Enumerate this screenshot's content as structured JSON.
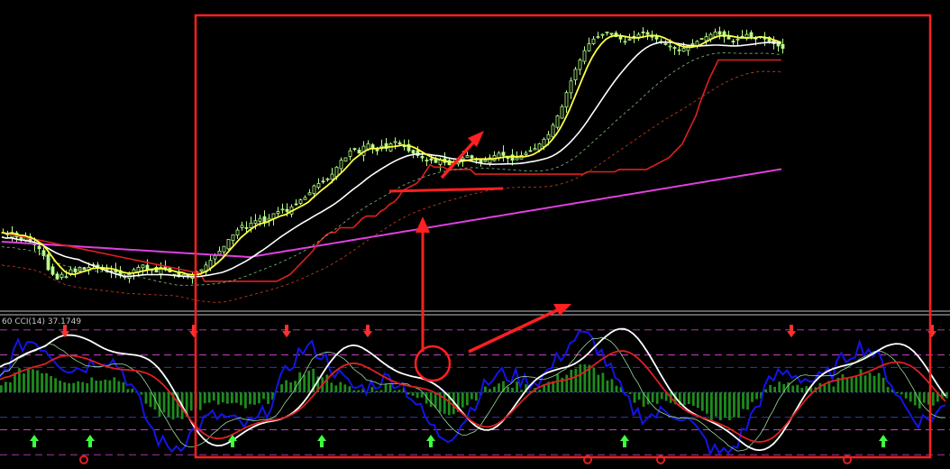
{
  "chart_data": [
    {
      "type": "candlestick",
      "panel": "price",
      "colors": {
        "background": "#000000",
        "candle_bull": "#b8ff8c",
        "candle_bear": "#b8ff8c",
        "ma_fast": "#ffff40",
        "ma_slow": "#ffffff",
        "ma_long": "#e040e0",
        "trail": "#e02020",
        "channel": "#7fbf7f",
        "trail_dashed": "#d04020"
      },
      "x_range": [
        0,
        210
      ],
      "y_range": [
        0,
        100
      ],
      "candles_close": [
        68,
        67,
        68,
        66,
        65,
        66,
        64,
        63,
        61,
        58,
        52,
        50,
        48,
        50,
        49,
        52,
        51,
        53,
        52,
        53,
        54,
        53,
        52,
        52,
        51,
        51,
        50,
        49,
        50,
        52,
        53,
        54,
        52,
        52,
        51,
        53,
        52,
        51,
        50,
        49,
        50,
        49,
        50,
        51,
        52,
        54,
        56,
        58,
        60,
        62,
        65,
        67,
        69,
        71,
        70,
        72,
        73,
        74,
        72,
        74,
        76,
        77,
        78,
        77,
        79,
        80,
        82,
        83,
        85,
        88,
        89,
        90,
        91,
        93,
        96,
        99,
        100,
        103,
        104,
        102,
        105,
        106,
        104,
        103,
        105,
        104,
        106,
        107,
        106,
        105,
        103,
        102,
        101,
        100,
        99,
        99,
        98,
        99,
        98,
        97,
        98,
        99,
        100,
        101,
        100,
        99,
        98,
        99,
        100,
        101,
        102,
        101,
        100,
        99,
        100,
        101,
        102,
        103,
        104,
        106,
        108,
        110,
        114,
        118,
        122,
        128,
        133,
        138,
        142,
        146,
        149,
        151,
        152,
        153,
        154,
        153,
        152,
        151,
        150,
        151,
        152,
        153,
        154,
        153,
        152,
        151,
        150,
        149,
        148,
        147,
        146,
        147,
        148,
        149,
        150,
        151,
        152,
        153,
        154,
        153,
        152,
        151,
        150,
        151,
        152,
        153,
        152,
        151,
        152,
        151,
        150,
        149,
        148,
        147
      ]
    },
    {
      "type": "line",
      "panel": "CCI",
      "label": "60  CCI(14) 37.1749",
      "y_range": [
        -300,
        300
      ],
      "levels": [
        250,
        150,
        100,
        0,
        -100,
        -150,
        -250
      ]
    }
  ]
}
